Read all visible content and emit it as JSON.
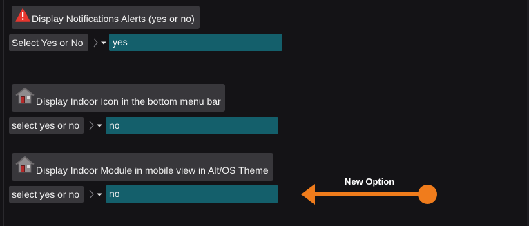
{
  "settings": [
    {
      "label": "Display Notifications Alerts (yes or no)",
      "icon": "warning-icon",
      "select_label": "Select Yes or No",
      "value": "yes"
    },
    {
      "label": "Display Indoor Icon in the bottom menu bar",
      "icon": "house-icon",
      "select_label": "select yes or no",
      "value": "no"
    },
    {
      "label": "Display Indoor Module in mobile view in Alt/OS Theme",
      "icon": "house-icon",
      "select_label": "select yes or no",
      "value": "no"
    }
  ],
  "annotation": {
    "text": "New Option",
    "color": "#f07c1c"
  },
  "colors": {
    "background": "#141316",
    "label_background": "#38373b",
    "field_background": "#145f6b",
    "warning": "#e8372f"
  }
}
